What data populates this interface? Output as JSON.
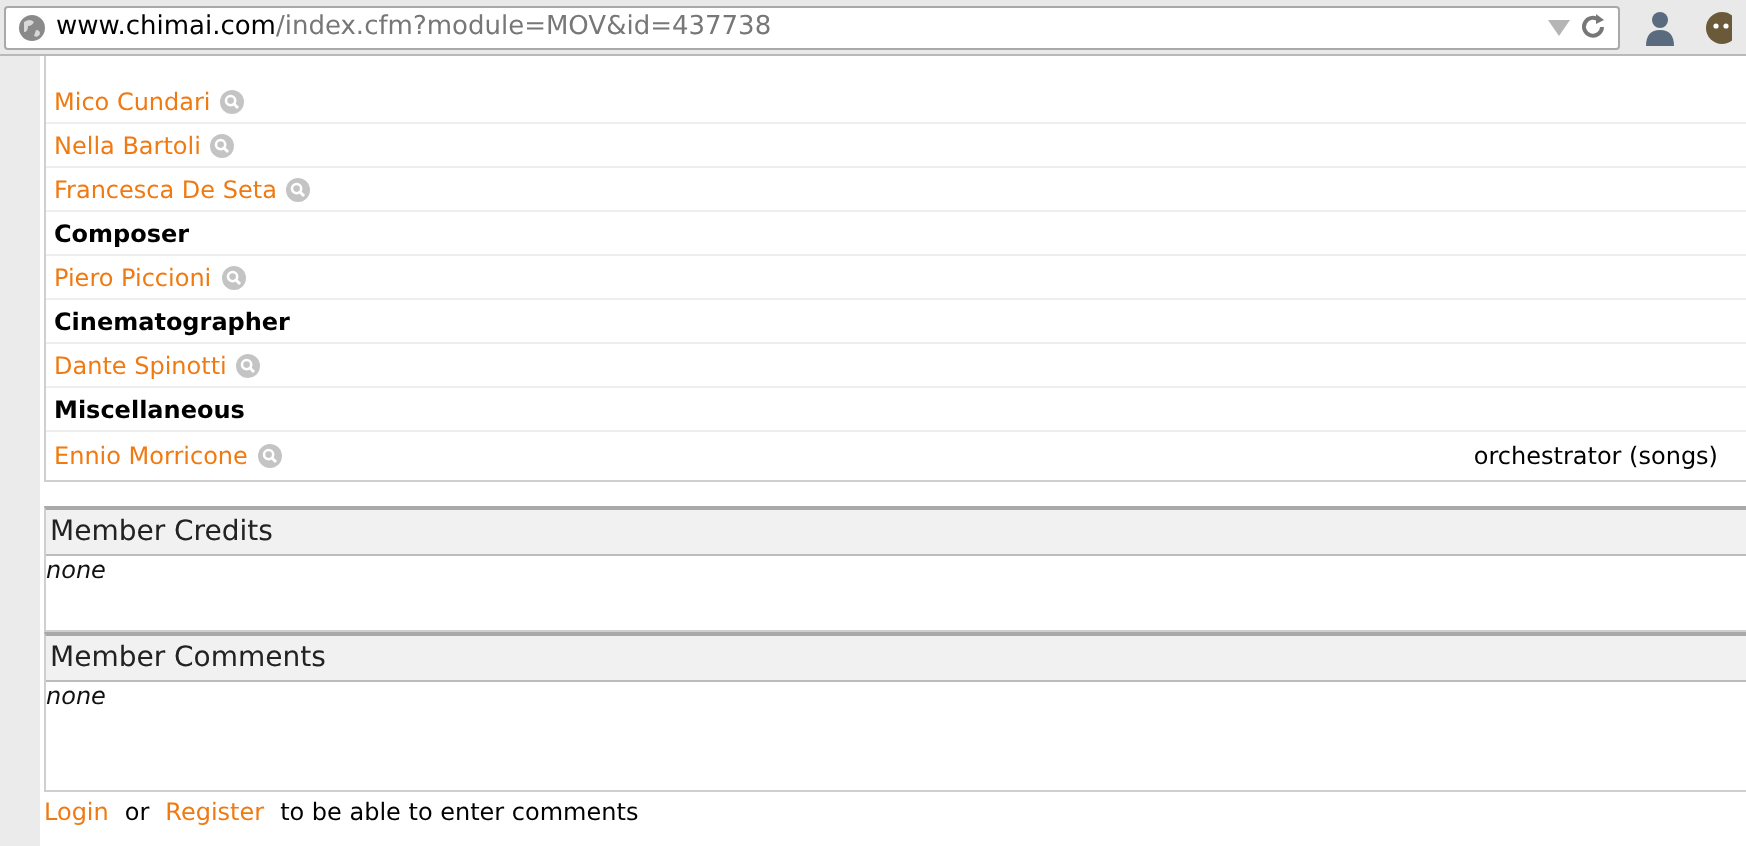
{
  "address_bar": {
    "url_host": "www.chimai.com",
    "url_path": "/index.cfm?module=MOV&id=437738"
  },
  "credits": [
    {
      "kind": "person",
      "name": "Mico Cundari"
    },
    {
      "kind": "person",
      "name": "Nella Bartoli"
    },
    {
      "kind": "person",
      "name": "Francesca De Seta"
    },
    {
      "kind": "heading",
      "name": "Composer"
    },
    {
      "kind": "person",
      "name": "Piero Piccioni"
    },
    {
      "kind": "heading",
      "name": "Cinematographer"
    },
    {
      "kind": "person",
      "name": "Dante Spinotti"
    },
    {
      "kind": "heading",
      "name": "Miscellaneous"
    },
    {
      "kind": "person",
      "name": "Ennio Morricone",
      "role": "orchestrator (songs)"
    }
  ],
  "sections": [
    {
      "title": "Member Credits",
      "body": "none"
    },
    {
      "title": "Member Comments",
      "body": "none"
    }
  ],
  "footer": {
    "login": "Login",
    "or": "or",
    "register": "Register",
    "rest": "to be able to enter comments"
  }
}
